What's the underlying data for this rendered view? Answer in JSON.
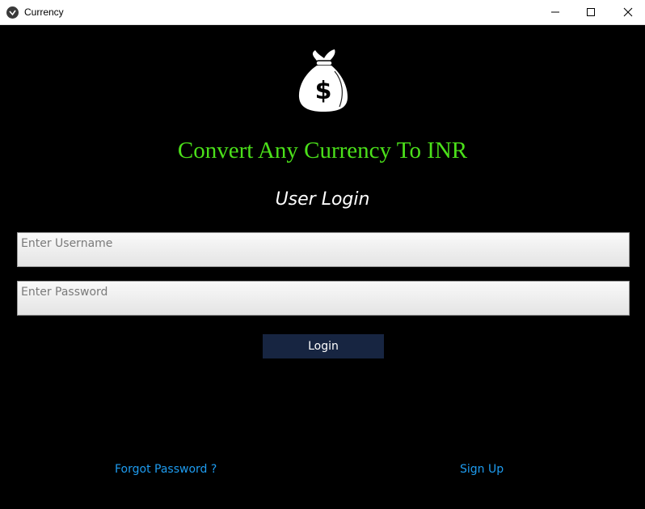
{
  "window": {
    "title": "Currency",
    "icon": "app-logo-icon"
  },
  "header": {
    "logo_icon": "money-bag-icon",
    "title": "Convert Any Currency To INR",
    "title_color": "#4be01a",
    "subtitle": "User Login"
  },
  "form": {
    "username_placeholder": "Enter Username",
    "password_placeholder": "Enter Password",
    "login_label": "Login",
    "login_bg": "#172541"
  },
  "links": {
    "forgot_password": "Forgot Password ?",
    "sign_up": "Sign Up",
    "link_color": "#1e9cf0"
  }
}
